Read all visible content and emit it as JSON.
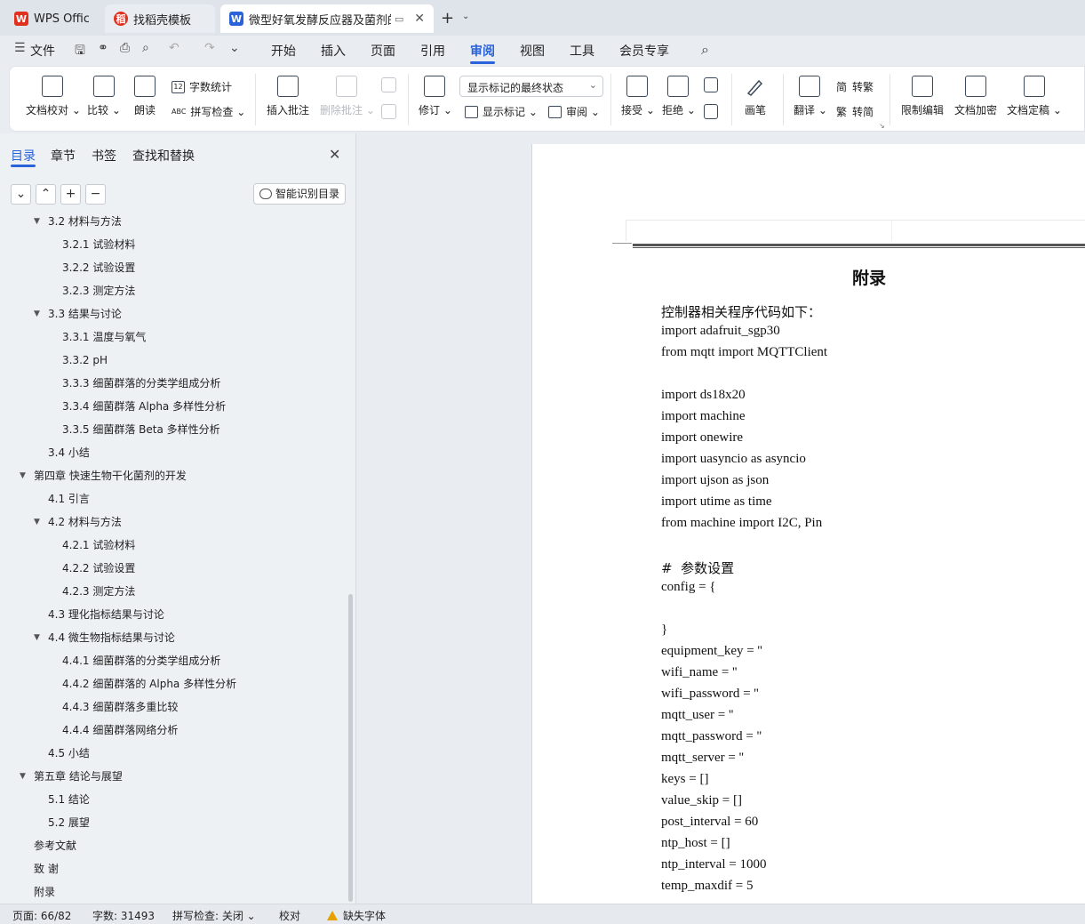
{
  "tabs": [
    {
      "label": "WPS Office",
      "icon": "wps-logo-icon",
      "color": "#e0301e"
    },
    {
      "label": "找稻壳模板",
      "icon": "docer-icon",
      "color": "#e0301e"
    },
    {
      "label": "微型好氧发酵反应器及菌剂的研",
      "icon": "word-doc-icon",
      "color": "#2a62d9"
    }
  ],
  "menu": {
    "file": "文件",
    "items": [
      "开始",
      "插入",
      "页面",
      "引用",
      "审阅",
      "视图",
      "工具",
      "会员专享"
    ],
    "active": "审阅"
  },
  "ribbon": {
    "doc_check": "文档校对",
    "compare": "比较",
    "read_aloud": "朗读",
    "word_count": "字数统计",
    "spell_check": "拼写检查",
    "insert_comment": "插入批注",
    "delete_comment": "删除批注",
    "revise": "修订",
    "markup_state": "显示标记的最终状态",
    "show_markup": "显示标记",
    "review": "审阅",
    "accept": "接受",
    "reject": "拒绝",
    "pen": "画笔",
    "translate": "翻译",
    "to_traditional": "转繁",
    "to_simplified": "转简",
    "restrict_edit": "限制编辑",
    "encrypt": "文档加密",
    "finalize": "文档定稿",
    "abc": "ABC",
    "num12": "12"
  },
  "nav": {
    "tabs": [
      "目录",
      "章节",
      "书签",
      "查找和替换"
    ],
    "active_tab": "目录",
    "smart_toc": "智能识别目录",
    "toc": [
      {
        "label": "3.2 材料与方法",
        "level": 2,
        "expanded": true
      },
      {
        "label": "3.2.1 试验材料",
        "level": 3
      },
      {
        "label": "3.2.2 试验设置",
        "level": 3
      },
      {
        "label": "3.2.3 测定方法",
        "level": 3
      },
      {
        "label": "3.3 结果与讨论",
        "level": 2,
        "expanded": true
      },
      {
        "label": "3.3.1 温度与氧气",
        "level": 3
      },
      {
        "label": "3.3.2 pH",
        "level": 3
      },
      {
        "label": "3.3.3 细菌群落的分类学组成分析",
        "level": 3
      },
      {
        "label": "3.3.4 细菌群落 Alpha 多样性分析",
        "level": 3
      },
      {
        "label": "3.3.5 细菌群落 Beta 多样性分析",
        "level": 3
      },
      {
        "label": "3.4 小结",
        "level": 2
      },
      {
        "label": "第四章  快速生物干化菌剂的开发",
        "level": 1,
        "expanded": true
      },
      {
        "label": "4.1 引言",
        "level": 2
      },
      {
        "label": "4.2 材料与方法",
        "level": 2,
        "expanded": true
      },
      {
        "label": "4.2.1 试验材料",
        "level": 3
      },
      {
        "label": "4.2.2 试验设置",
        "level": 3
      },
      {
        "label": "4.2.3 测定方法",
        "level": 3
      },
      {
        "label": "4.3 理化指标结果与讨论",
        "level": 2
      },
      {
        "label": "4.4 微生物指标结果与讨论",
        "level": 2,
        "expanded": true
      },
      {
        "label": "4.4.1 细菌群落的分类学组成分析",
        "level": 3
      },
      {
        "label": "4.4.2 细菌群落的 Alpha 多样性分析",
        "level": 3
      },
      {
        "label": "4.4.3 细菌群落多重比较",
        "level": 3
      },
      {
        "label": "4.4.4 细菌群落网络分析",
        "level": 3
      },
      {
        "label": "4.5 小结",
        "level": 2
      },
      {
        "label": "第五章  结论与展望",
        "level": 1,
        "expanded": true
      },
      {
        "label": "5.1 结论",
        "level": 2
      },
      {
        "label": "5.2 展望",
        "level": 2
      },
      {
        "label": "参考文献",
        "level": 1
      },
      {
        "label": "致  谢",
        "level": 1
      },
      {
        "label": "附录",
        "level": 1
      }
    ]
  },
  "document": {
    "title": "附录",
    "lines": [
      "控制器相关程序代码如下：",
      "import adafruit_sgp30",
      "from mqtt import MQTTClient",
      "",
      "import ds18x20",
      "import machine",
      "import onewire",
      "import uasyncio as asyncio",
      "import ujson as json",
      "import utime as time",
      "from machine import I2C, Pin",
      "",
      "#  参数设置",
      "config = {",
      "",
      "}",
      "equipment_key = ''",
      "wifi_name = ''",
      "wifi_password = ''",
      "mqtt_user = ''",
      "mqtt_password = ''",
      "mqtt_server = ''",
      "keys = []",
      "value_skip = []",
      "post_interval = 60",
      "ntp_host = []",
      "ntp_interval = 1000",
      "temp_maxdif = 5"
    ]
  },
  "status": {
    "page": "页面: 66/82",
    "word_count": "字数: 31493",
    "spell_check": "拼写检查: 关闭",
    "proofread": "校对",
    "missing_font": "缺失字体"
  },
  "colors": {
    "accent": "#2a62d9",
    "warning": "#e6a000"
  }
}
